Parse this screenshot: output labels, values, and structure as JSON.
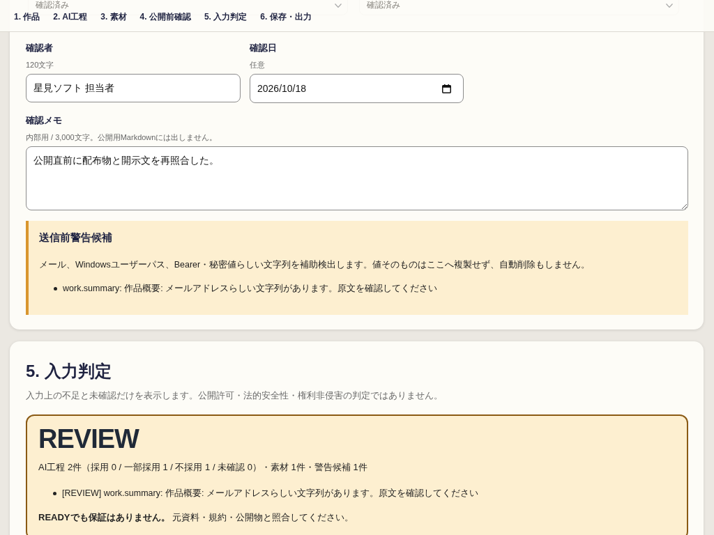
{
  "status_selects": [
    {
      "value": "確認済み"
    },
    {
      "value": "確認済み"
    }
  ],
  "nav": {
    "items": [
      {
        "label": "1. 作品"
      },
      {
        "label": "2. AI工程"
      },
      {
        "label": "3. 素材"
      },
      {
        "label": "4. 公開前確認"
      },
      {
        "label": "5. 入力判定"
      },
      {
        "label": "6. 保存・出力"
      }
    ]
  },
  "review_fields": {
    "reviewer": {
      "label": "確認者",
      "hint": "120文字",
      "value": "星見ソフト 担当者"
    },
    "date": {
      "label": "確認日",
      "hint": "任意",
      "value": "2026/10/18"
    },
    "memo": {
      "label": "確認メモ",
      "hint": "内部用 / 3,000文字。公開用Markdownには出しません。",
      "value": "公開直前に配布物と開示文を再照合した。"
    }
  },
  "warning_box": {
    "title": "送信前警告候補",
    "description": "メール、Windowsユーザーパス、Bearer・秘密値らしい文字列を補助検出します。値そのものはここへ複製せず、自動削除もしません。",
    "items": [
      "work.summary: 作品概要: メールアドレスらしい文字列があります。原文を確認してください"
    ]
  },
  "judgement_section": {
    "title": "5. 入力判定",
    "description": "入力上の不足と未確認だけを表示します。公開許可・法的安全性・権利非侵害の判定ではありません。",
    "result": {
      "status": "REVIEW",
      "summary": "AI工程 2件（採用 0 / 一部採用 1 / 不採用 1 / 未確認 0）・素材 1件・警告候補 1件",
      "items": [
        "[REVIEW] work.summary: 作品概要: メールアドレスらしい文字列があります。原文を確認してください"
      ],
      "note": "**READYでも保証はありません。** 元資料・規約・公開物と照合してください。"
    }
  }
}
